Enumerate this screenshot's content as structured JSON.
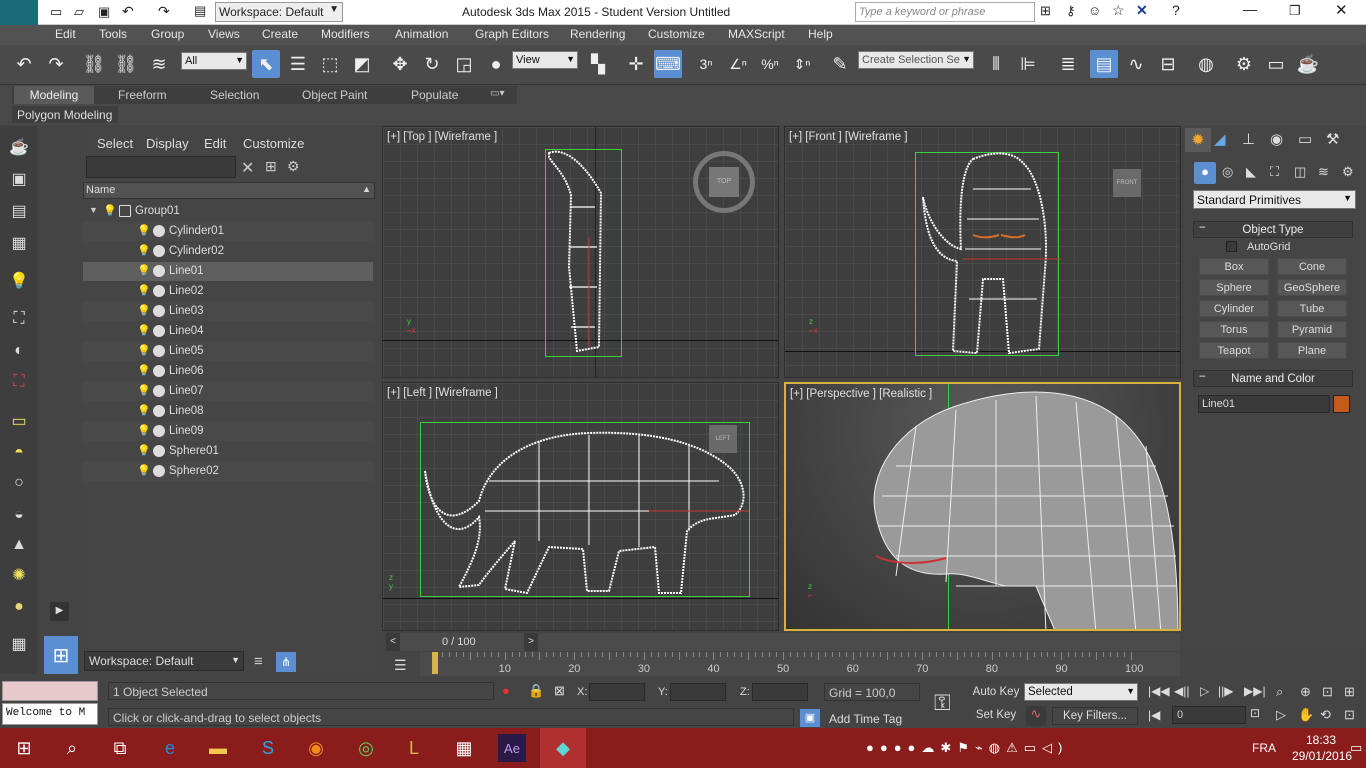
{
  "app": {
    "workspace": "Workspace: Default",
    "title": "Autodesk 3ds Max 2015 - Student Version   Untitled",
    "search_placeholder": "Type a keyword or phrase"
  },
  "menus": [
    "Edit",
    "Tools",
    "Group",
    "Views",
    "Create",
    "Modifiers",
    "Animation",
    "Graph Editors",
    "Rendering",
    "Customize",
    "MAXScript",
    "Help"
  ],
  "toolbar": {
    "filter_value": "All",
    "ref_coord_value": "View",
    "selection_set_placeholder": "Create Selection Se",
    "snap_labels": [
      "3",
      "%"
    ]
  },
  "ribbon": {
    "tabs": [
      "Modeling",
      "Freeform",
      "Selection",
      "Object Paint",
      "Populate"
    ],
    "subtab": "Polygon Modeling"
  },
  "explorer": {
    "menu": [
      "Select",
      "Display",
      "Edit",
      "Customize"
    ],
    "column_header": "Name",
    "items": [
      "Group01",
      "Cylinder01",
      "Cylinder02",
      "Line01",
      "Line02",
      "Line03",
      "Line04",
      "Line05",
      "Line06",
      "Line07",
      "Line08",
      "Line09",
      "Sphere01",
      "Sphere02"
    ],
    "selected": "Line01",
    "workspace_label": "Workspace: Default"
  },
  "viewports": {
    "top": "[+] [Top ] [Wireframe ]",
    "front": "[+] [Front ] [Wireframe ]",
    "left": "[+] [Left ] [Wireframe ]",
    "persp": "[+] [Perspective ] [Realistic ]",
    "cube_top": "TOP",
    "cube_front": "FRONT",
    "cube_left": "LEFT"
  },
  "command_panel": {
    "category": "Standard Primitives",
    "object_type_title": "Object Type",
    "autogrid": "AutoGrid",
    "buttons": [
      "Box",
      "Cone",
      "Sphere",
      "GeoSphere",
      "Cylinder",
      "Tube",
      "Torus",
      "Pyramid",
      "Teapot",
      "Plane"
    ],
    "name_color_title": "Name and Color",
    "object_name": "Line01",
    "object_color": "#c15a1b"
  },
  "timeline": {
    "frame_label": "0 / 100",
    "ticks": [
      "10",
      "20",
      "30",
      "40",
      "50",
      "60",
      "70",
      "80",
      "90",
      "100"
    ]
  },
  "status": {
    "maxscript_mini": "Welcome to M",
    "selection": "1 Object Selected",
    "hint": "Click or click-and-drag to select objects",
    "x_label": "X:",
    "y_label": "Y:",
    "z_label": "Z:",
    "grid": "Grid = 100,0",
    "add_time_tag": "Add Time Tag",
    "auto_key": "Auto Key",
    "set_key": "Set Key",
    "key_mode": "Selected",
    "key_filters": "Key Filters...",
    "frame_value": "0"
  },
  "taskbar": {
    "lang": "FRA",
    "time": "18:33",
    "date": "29/01/2016"
  }
}
